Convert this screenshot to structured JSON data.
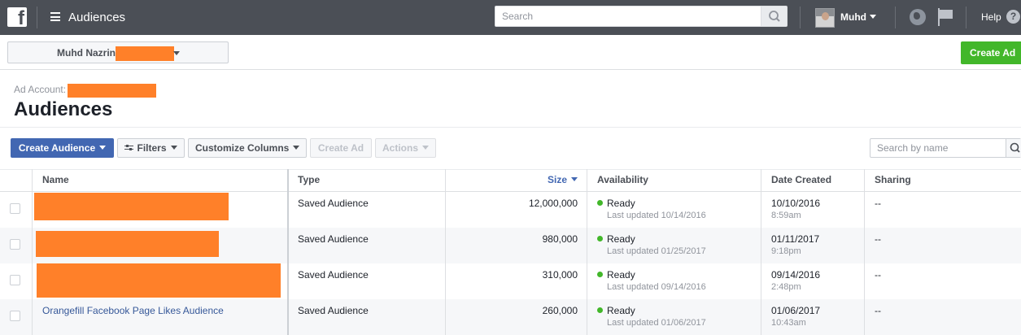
{
  "topbar": {
    "logo_letter": "f",
    "app_title": "Audiences",
    "search_placeholder": "Search",
    "user_name": "Muhd",
    "help_label": "Help",
    "help_glyph": "?"
  },
  "account": {
    "name": "Muhd Nazrin",
    "create_ad": "Create Ad"
  },
  "header": {
    "ad_account_label": "Ad Account:",
    "title": "Audiences"
  },
  "toolbar": {
    "create_audience": "Create Audience",
    "filters": "Filters",
    "customize_columns": "Customize Columns",
    "create_ad": "Create Ad",
    "actions": "Actions",
    "search_placeholder": "Search by name"
  },
  "table": {
    "columns": {
      "name": "Name",
      "type": "Type",
      "size": "Size",
      "availability": "Availability",
      "date_created": "Date Created",
      "sharing": "Sharing"
    },
    "rows": [
      {
        "name": "",
        "type": "Saved Audience",
        "size": "12,000,000",
        "status": "Ready",
        "updated": "Last updated 10/14/2016",
        "date": "10/10/2016",
        "time": "8:59am",
        "sharing": "--"
      },
      {
        "name": "",
        "type": "Saved Audience",
        "size": "980,000",
        "status": "Ready",
        "updated": "Last updated 01/25/2017",
        "date": "01/11/2017",
        "time": "9:18pm",
        "sharing": "--"
      },
      {
        "name": "",
        "type": "Saved Audience",
        "size": "310,000",
        "status": "Ready",
        "updated": "Last updated 09/14/2016",
        "date": "09/14/2016",
        "time": "2:48pm",
        "sharing": "--"
      },
      {
        "name": "Orangefill Facebook Page Likes Audience",
        "type": "Saved Audience",
        "size": "260,000",
        "status": "Ready",
        "updated": "Last updated 01/06/2017",
        "date": "01/06/2017",
        "time": "10:43am",
        "sharing": "--"
      }
    ]
  },
  "colors": {
    "topbar": "#4b4f56",
    "primary": "#4267b2",
    "green": "#42b72a",
    "redaction": "#ff8029",
    "link": "#365899"
  },
  "icons": [
    "facebook-logo-icon",
    "hamburger-icon",
    "search-icon",
    "globe-icon",
    "flag-icon",
    "help-icon",
    "filter-icon",
    "chevron-down-icon"
  ]
}
